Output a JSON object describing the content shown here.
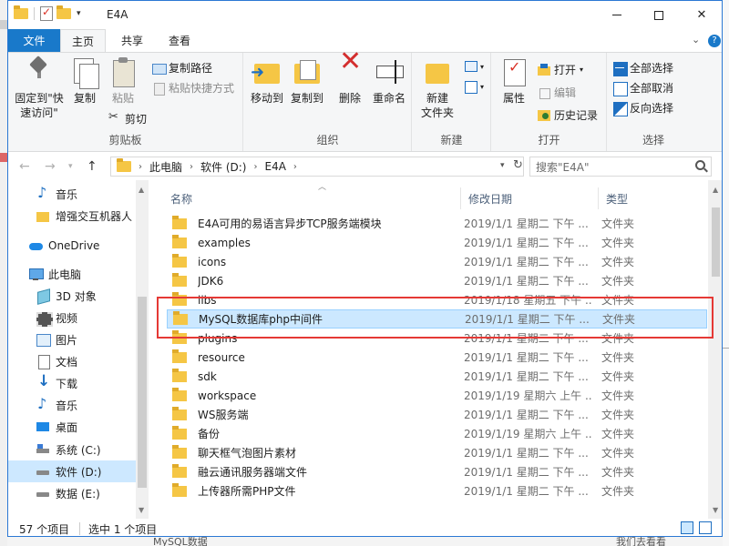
{
  "window": {
    "title": "E4A"
  },
  "tabs": [
    {
      "label": "文件"
    },
    {
      "label": "主页"
    },
    {
      "label": "共享"
    },
    {
      "label": "查看"
    }
  ],
  "ribbon": {
    "clipboard": {
      "label": "剪贴板",
      "pin_label": "固定到\"快\n速访问\"",
      "copy_label": "复制",
      "paste_label": "粘贴",
      "copy_path_label": "复制路径",
      "paste_shortcut_label": "粘贴快捷方式",
      "cut_label": "剪切"
    },
    "organize": {
      "label": "组织",
      "move_to_label": "移动到",
      "copy_to_label": "复制到",
      "delete_label": "删除",
      "rename_label": "重命名"
    },
    "new": {
      "label": "新建",
      "new_folder_label": "新建\n文件夹"
    },
    "open": {
      "label": "打开",
      "properties_label": "属性",
      "open_label": "打开",
      "edit_label": "编辑",
      "history_label": "历史记录"
    },
    "select": {
      "label": "选择",
      "select_all_label": "全部选择",
      "select_none_label": "全部取消",
      "invert_label": "反向选择"
    }
  },
  "address": {
    "crumbs": [
      "此电脑",
      "软件 (D:)",
      "E4A"
    ],
    "search_placeholder": "搜索\"E4A\""
  },
  "nav": [
    {
      "label": "音乐",
      "icon": "music-icon"
    },
    {
      "label": "增强交互机器人",
      "icon": "folder-icon"
    },
    {
      "label": "OneDrive",
      "icon": "onedrive-icon"
    },
    {
      "label": "此电脑",
      "icon": "computer-icon"
    },
    {
      "label": "3D 对象",
      "icon": "3d-objects-icon"
    },
    {
      "label": "视频",
      "icon": "video-icon"
    },
    {
      "label": "图片",
      "icon": "pictures-icon"
    },
    {
      "label": "文档",
      "icon": "documents-icon"
    },
    {
      "label": "下载",
      "icon": "downloads-icon"
    },
    {
      "label": "音乐",
      "icon": "music-icon"
    },
    {
      "label": "桌面",
      "icon": "desktop-icon"
    },
    {
      "label": "系统 (C:)",
      "icon": "system-drive-icon"
    },
    {
      "label": "软件 (D:)",
      "icon": "drive-icon"
    },
    {
      "label": "数据 (E:)",
      "icon": "drive-icon"
    }
  ],
  "columns": {
    "name": "名称",
    "date": "修改日期",
    "type": "类型"
  },
  "files": [
    {
      "name": "E4A可用的易语言异步TCP服务端模块",
      "date": "2019/1/1 星期二 下午 ...",
      "type": "文件夹"
    },
    {
      "name": "examples",
      "date": "2019/1/1 星期二 下午 ...",
      "type": "文件夹"
    },
    {
      "name": "icons",
      "date": "2019/1/1 星期二 下午 ...",
      "type": "文件夹"
    },
    {
      "name": "JDK6",
      "date": "2019/1/1 星期二 下午 ...",
      "type": "文件夹"
    },
    {
      "name": "libs",
      "date": "2019/1/18 星期五 下午 ...",
      "type": "文件夹"
    },
    {
      "name": "MySQL数据库php中间件",
      "date": "2019/1/1 星期二 下午 ...",
      "type": "文件夹"
    },
    {
      "name": "plugins",
      "date": "2019/1/1 星期二 下午 ...",
      "type": "文件夹"
    },
    {
      "name": "resource",
      "date": "2019/1/1 星期二 下午 ...",
      "type": "文件夹"
    },
    {
      "name": "sdk",
      "date": "2019/1/1 星期二 下午 ...",
      "type": "文件夹"
    },
    {
      "name": "workspace",
      "date": "2019/1/19 星期六 上午 ...",
      "type": "文件夹"
    },
    {
      "name": "WS服务端",
      "date": "2019/1/1 星期二 下午 ...",
      "type": "文件夹"
    },
    {
      "name": "备份",
      "date": "2019/1/19 星期六 上午 ...",
      "type": "文件夹"
    },
    {
      "name": "聊天框气泡图片素材",
      "date": "2019/1/1 星期二 下午 ...",
      "type": "文件夹"
    },
    {
      "name": "融云通讯服务器端文件",
      "date": "2019/1/1 星期二 下午 ...",
      "type": "文件夹"
    },
    {
      "name": "上传器所需PHP文件",
      "date": "2019/1/1 星期二 下午 ...",
      "type": "文件夹"
    }
  ],
  "status": {
    "item_count": "57 个项目",
    "selected": "选中 1 个项目"
  },
  "background": {
    "bottom_text": "MySQL数据",
    "bottom_right_text": "我们去看看"
  }
}
